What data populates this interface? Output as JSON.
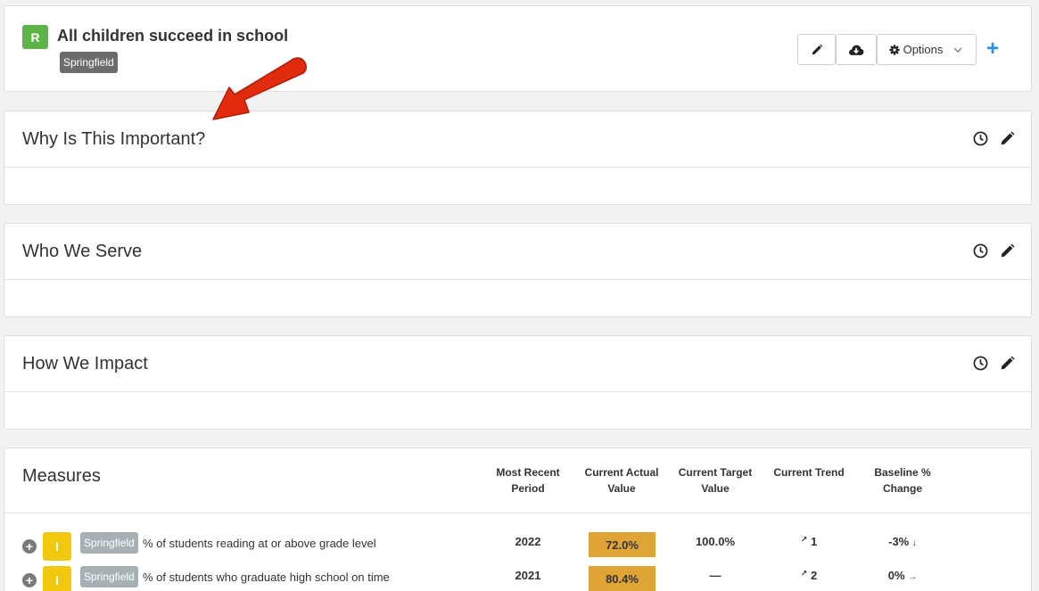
{
  "header": {
    "status_badge": "R",
    "title": "All children succeed in school",
    "location_tag": "Springfield",
    "options_label": "Options",
    "add_label": "+"
  },
  "sections": [
    {
      "title": "Why Is This Important?"
    },
    {
      "title": "Who We Serve"
    },
    {
      "title": "How We Impact"
    }
  ],
  "measures": {
    "title": "Measures",
    "columns": {
      "period": [
        "Most Recent",
        "Period"
      ],
      "actual": [
        "Current Actual",
        "Value"
      ],
      "target": [
        "Current Target",
        "Value"
      ],
      "trend": "Current Trend",
      "change": "Baseline % Change"
    },
    "rows": [
      {
        "badge": "I",
        "location": "Springfield",
        "name": "% of students reading at or above grade level",
        "period": "2022",
        "actual": "72.0%",
        "target": "100.0%",
        "trend_arrow": "↗",
        "trend": "1",
        "change": "-3%",
        "change_arrow": "↓"
      },
      {
        "badge": "I",
        "location": "Springfield",
        "name": "% of students who graduate high school on time",
        "period": "2021",
        "actual": "80.4%",
        "target": "—",
        "trend_arrow": "↗",
        "trend": "2",
        "change": "0%",
        "change_arrow": "→"
      }
    ]
  },
  "colors": {
    "status_red_badge": "#5cb346",
    "indicator_badge": "#f2c80f",
    "actual_value_bg": "#e0a336",
    "accent_blue": "#2a8de8",
    "annotation_arrow": "#e02b0f"
  },
  "icons": [
    "pencil-icon",
    "cloud-download-icon",
    "gear-icon",
    "chevron-down-icon",
    "plus-icon",
    "clock-icon",
    "plus-circle-icon"
  ]
}
